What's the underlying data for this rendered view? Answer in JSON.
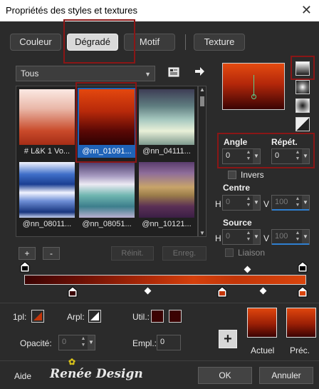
{
  "window": {
    "title": "Propriétés des styles et textures",
    "close_glyph": "✕"
  },
  "tabs": [
    {
      "label": "Couleur",
      "active": false
    },
    {
      "label": "Dégradé",
      "active": true
    },
    {
      "label": "Motif",
      "active": false
    },
    {
      "label": "Texture",
      "active": false
    }
  ],
  "gradient_picker": {
    "category": "Tous",
    "swatches": [
      {
        "caption": "# L&K 1 Vo...",
        "selected": false
      },
      {
        "caption": "@nn_01091...",
        "selected": true
      },
      {
        "caption": "@nn_04111...",
        "selected": false
      },
      {
        "caption": "@nn_08011...",
        "selected": false
      },
      {
        "caption": "@nn_08051...",
        "selected": false
      },
      {
        "caption": "@nn_10121...",
        "selected": false
      }
    ],
    "add_label": "+",
    "remove_label": "-",
    "reset_label": "Réinit.",
    "save_label": "Enreg."
  },
  "settings": {
    "angle_label": "Angle",
    "angle_value": "0",
    "repeat_label": "Répét.",
    "repeat_value": "0",
    "invert_label": "Invers",
    "center_label": "Centre",
    "h_label": "H",
    "v_label": "V",
    "center_h": "0",
    "center_v": "100",
    "source_label": "Source",
    "source_h": "0",
    "source_v": "100",
    "link_label": "Liaison"
  },
  "bottom": {
    "stop_color_label": "1pl:",
    "bg_color_label": "Arpl:",
    "user_label": "Util.:",
    "opacity_label": "Opacité:",
    "opacity_value": "0",
    "location_label": "Empl.:",
    "location_value": "0",
    "current_label": "Actuel",
    "previous_label": "Préc.",
    "add_glyph": "+"
  },
  "footer": {
    "help_label": "Aide",
    "logo_text": "Renée Design",
    "ok_label": "OK",
    "cancel_label": "Annuler"
  },
  "colors": {
    "accent_blue": "#1f63b8",
    "highlight_red": "#8a1616",
    "stop_dark": "#3b0303",
    "stop_orange": "#d9450d"
  }
}
